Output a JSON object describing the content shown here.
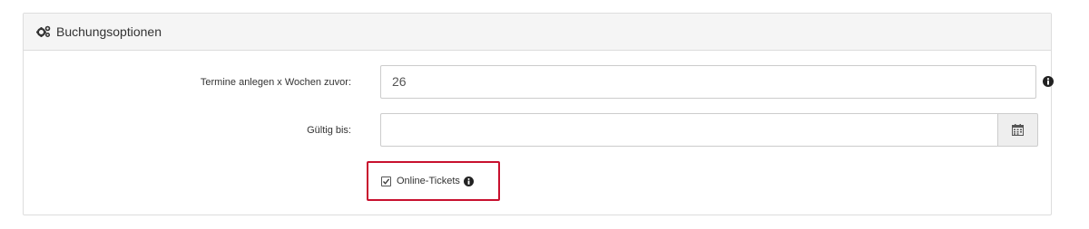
{
  "panel": {
    "title": "Buchungsoptionen",
    "icon": "cogs-icon"
  },
  "fields": {
    "weeks_label": "Termine anlegen x Wochen zuvor:",
    "weeks_value": "26",
    "valid_until_label": "Gültig bis:",
    "valid_until_value": ""
  },
  "online_tickets": {
    "label": "Online-Tickets",
    "checked": true
  },
  "colors": {
    "highlight": "#c8102e",
    "heading_bg": "#f5f5f5",
    "addon_bg": "#eeeeee"
  }
}
